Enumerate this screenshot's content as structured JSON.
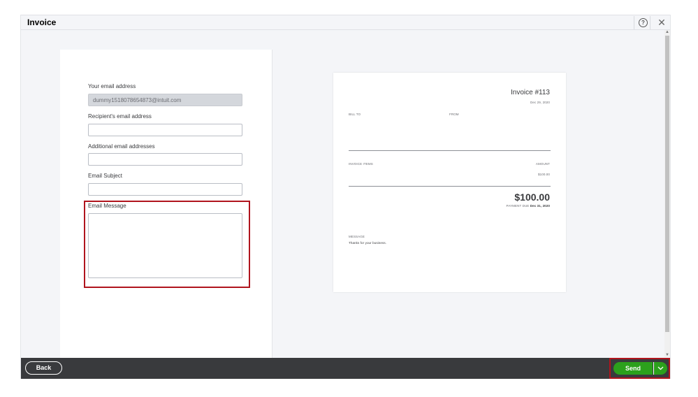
{
  "window": {
    "title": "Invoice",
    "help_glyph": "?",
    "close_glyph": "✕"
  },
  "form": {
    "your_email_label": "Your email address",
    "your_email_value": "dummy1518078654873@intuit.com",
    "recipient_label": "Recipient's email address",
    "recipient_value": "",
    "additional_label": "Additional email addresses",
    "additional_value": "",
    "subject_label": "Email Subject",
    "subject_value": "",
    "message_label": "Email Message",
    "message_value": ""
  },
  "preview": {
    "invoice_title": "Invoice #113",
    "invoice_date": "Dec 29, 2020",
    "bill_to_label": "BILL TO",
    "from_label": "FROM",
    "items_label": "INVOICE ITEMS",
    "amount_label": "AMOUNT",
    "amount_value": "$100.00",
    "total": "$100.00",
    "payment_due_label": "PAYMENT DUE",
    "payment_due_date": "Dec 31, 2020",
    "message_label": "MESSAGE",
    "message_text": "Thanks for your business."
  },
  "footer": {
    "back_label": "Back",
    "send_label": "Send"
  },
  "icons": {
    "help": "help-icon",
    "close": "close-icon",
    "caret": "chevron-down-icon"
  },
  "colors": {
    "accent_green": "#2ca01c",
    "footer_bg": "#393a3d",
    "highlight_red": "#b0141d"
  }
}
